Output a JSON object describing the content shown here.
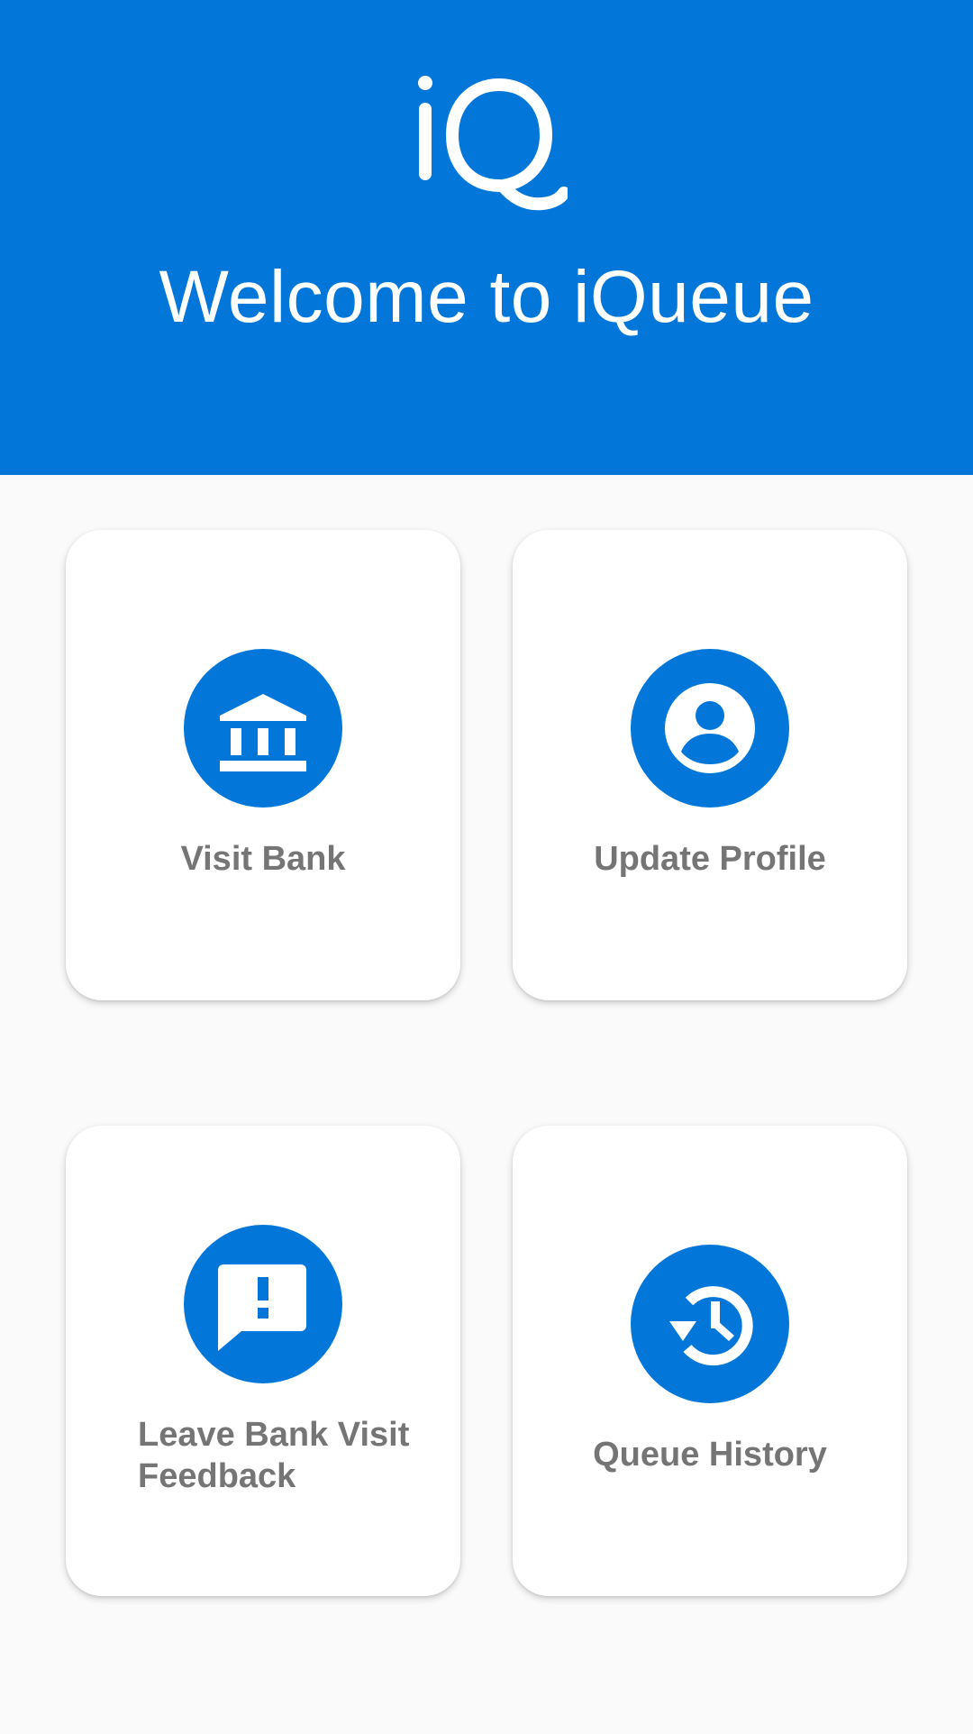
{
  "header": {
    "logo_text": "iQ",
    "welcome_title": "Welcome to iQueue",
    "background_color": "#0276d9"
  },
  "menu": {
    "visit_bank": {
      "label": "Visit Bank",
      "icon": "bank-icon"
    },
    "update_profile": {
      "label": "Update Profile",
      "icon": "account-circle-icon"
    },
    "leave_feedback": {
      "label": "Leave Bank Visit Feedback",
      "icon": "feedback-icon"
    },
    "queue_history": {
      "label": "Queue History",
      "icon": "history-icon"
    }
  },
  "colors": {
    "accent": "#0276d9",
    "card_background": "#ffffff",
    "page_background": "#fafafa",
    "label_text": "#757575"
  }
}
